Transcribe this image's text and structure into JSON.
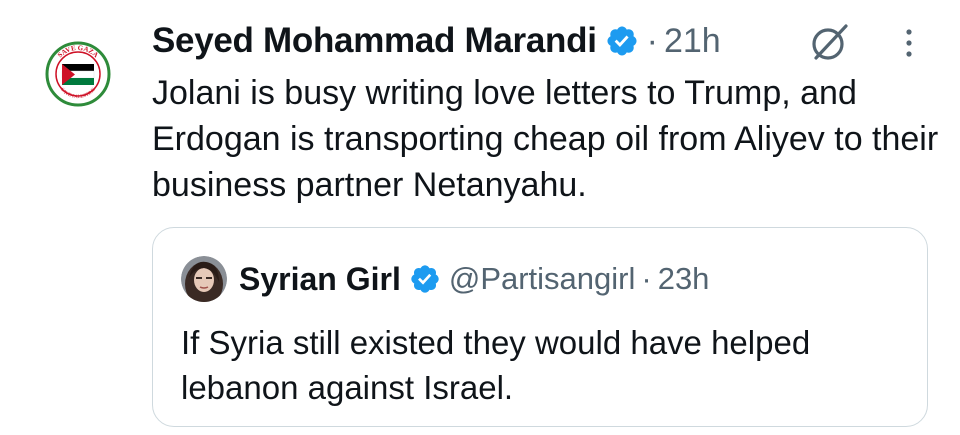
{
  "tweet": {
    "author_name": "Seyed Mohammad Marandi",
    "separator": "·",
    "time": "21h",
    "text": "Jolani is busy writing love letters to Trump, and Erdogan is transporting cheap oil from Aliyev to their business partner Netanyahu.",
    "avatar_icon": "save-gaza-palestine-flag-badge",
    "avatar_ring_text_top": "SAVE GAZA",
    "avatar_ring_text_bottom": "SAVE PALESTINE"
  },
  "quote": {
    "author_name": "Syrian Girl",
    "handle": "@Partisangirl",
    "separator": "·",
    "time": "23h",
    "text": "If Syria still existed they would have helped lebanon against Israel."
  },
  "colors": {
    "verified": "#1d9bf0",
    "secondary_text": "#536471",
    "border": "#cfd9de",
    "flag_red": "#ce1126",
    "flag_green": "#007a3d",
    "badge_ring": "#2e8b3a"
  }
}
